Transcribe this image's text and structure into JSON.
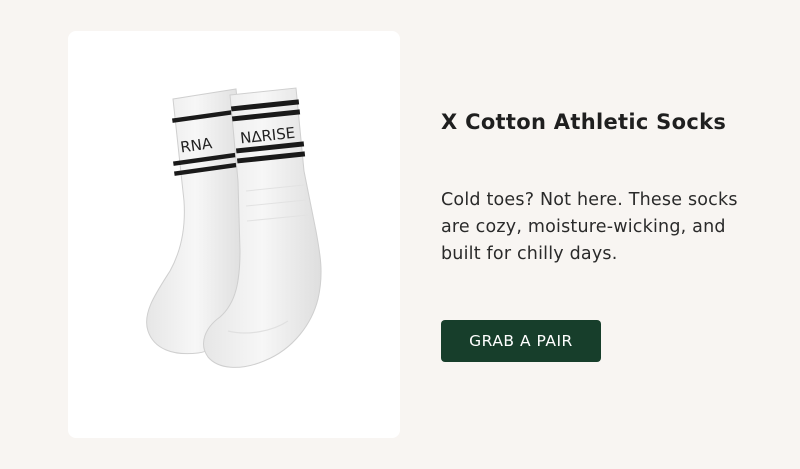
{
  "product": {
    "title": "X Cotton Athletic Socks",
    "description": "Cold toes? Not here. These socks are cozy, moisture-wicking, and built for chilly days.",
    "cta_label": "GRAB A PAIR",
    "image_icon": "socks-product-image",
    "sock_brand_text": "RNARISE"
  },
  "colors": {
    "background": "#f8f5f2",
    "card": "#ffffff",
    "button": "#173e2b",
    "stripe": "#1a1a1a"
  }
}
